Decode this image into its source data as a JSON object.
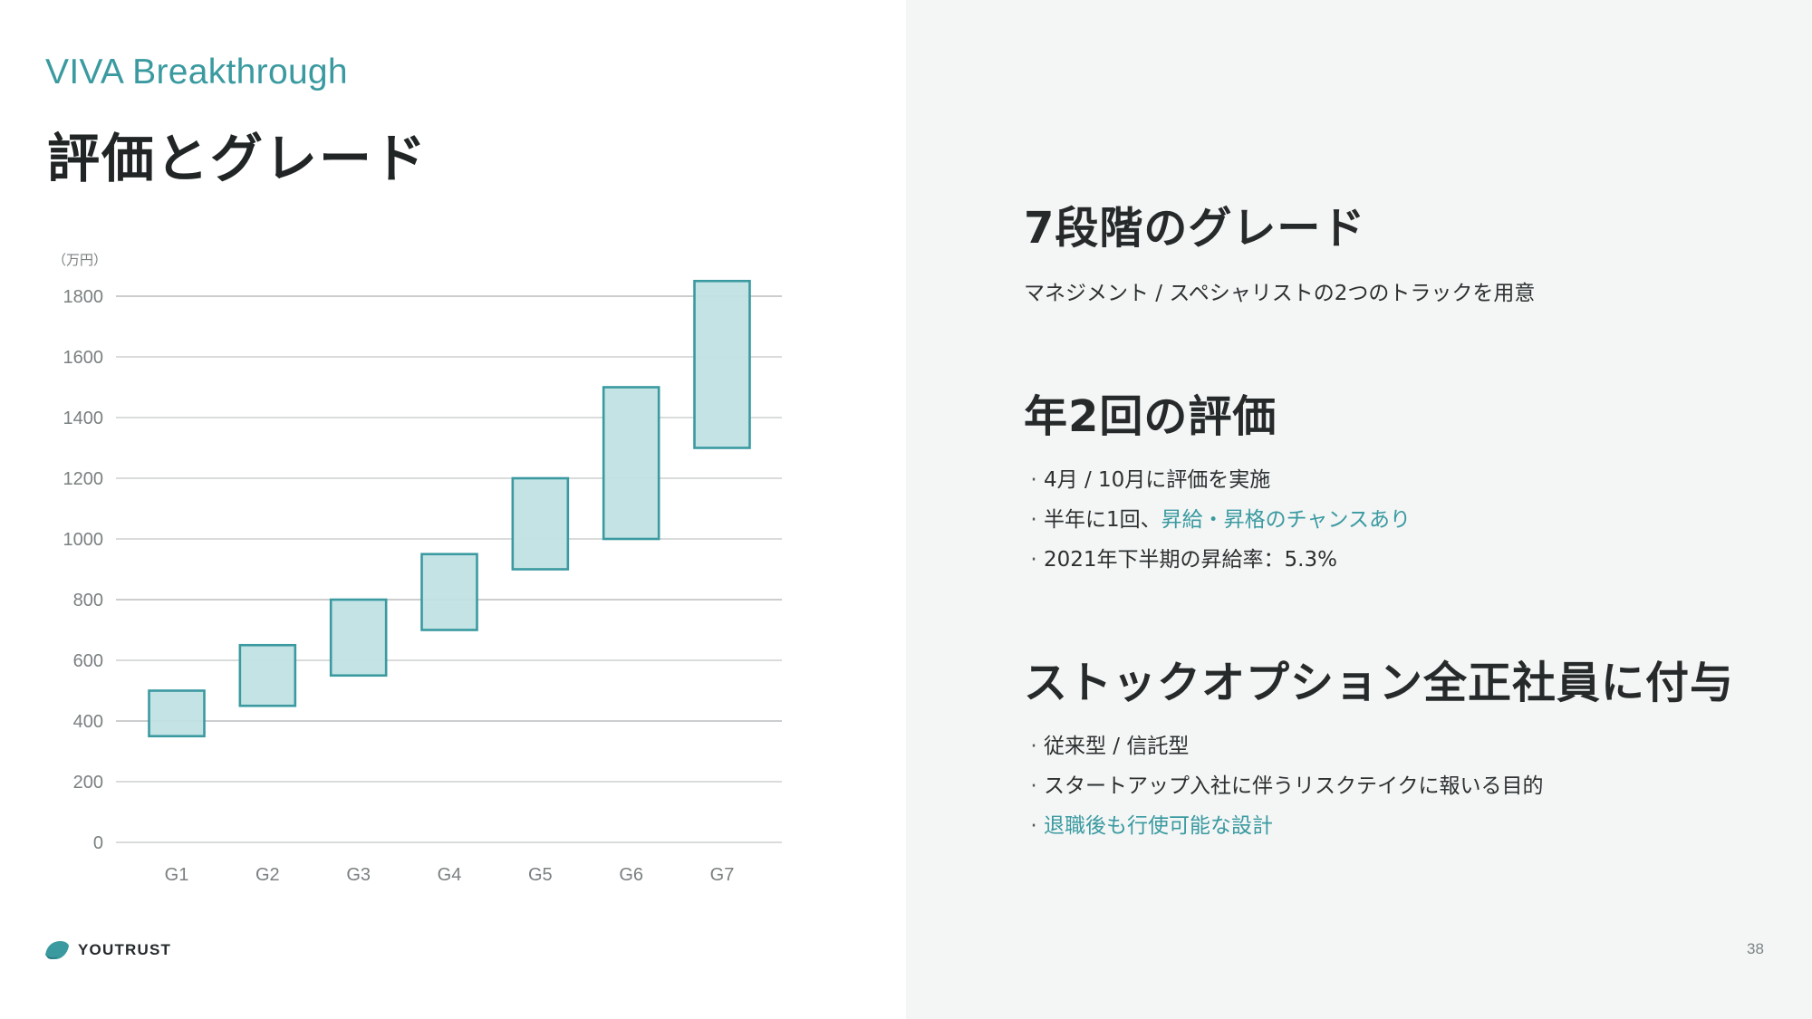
{
  "header": {
    "brand": "VIVA Breakthrough",
    "title": "評価とグレード"
  },
  "chart_data": {
    "type": "bar",
    "subtype": "floating-range",
    "title": "",
    "unit_label": "（万円）",
    "xlabel": "",
    "ylabel": "（万円）",
    "categories": [
      "G1",
      "G2",
      "G3",
      "G4",
      "G5",
      "G6",
      "G7"
    ],
    "ranges": [
      {
        "category": "G1",
        "low": 350,
        "high": 500
      },
      {
        "category": "G2",
        "low": 450,
        "high": 650
      },
      {
        "category": "G3",
        "low": 550,
        "high": 800
      },
      {
        "category": "G4",
        "low": 700,
        "high": 950
      },
      {
        "category": "G5",
        "low": 900,
        "high": 1200
      },
      {
        "category": "G6",
        "low": 1000,
        "high": 1500
      },
      {
        "category": "G7",
        "low": 1300,
        "high": 1850
      }
    ],
    "yticks": [
      0,
      200,
      400,
      600,
      800,
      1000,
      1200,
      1400,
      1600,
      1800
    ],
    "ylim": [
      0,
      1800
    ],
    "grid": true,
    "legend": "none",
    "colors": {
      "fill": "#c1e2e4",
      "stroke": "#3a9aa0",
      "grid": "#c4c6c7"
    }
  },
  "sections": [
    {
      "heading": "7段階のグレード",
      "sub": "マネジメント / スペシャリストの2つのトラックを用意"
    },
    {
      "heading": "年2回の評価",
      "bullets": [
        {
          "plain": "4月 / 10月に評価を実施",
          "accent": ""
        },
        {
          "plain": "半年に1回、",
          "accent": "昇給・昇格のチャンスあり"
        },
        {
          "plain": "2021年下半期の昇給率：5.3%",
          "accent": ""
        }
      ]
    },
    {
      "heading": "ストックオプション全正社員に付与",
      "bullets": [
        {
          "plain": "従来型 / 信託型",
          "accent": ""
        },
        {
          "plain": "スタートアップ入社に伴うリスクテイクに報いる目的",
          "accent": ""
        },
        {
          "plain": "",
          "accent": "退職後も行使可能な設計"
        }
      ]
    }
  ],
  "bullet_glyph": "·",
  "footer": {
    "logo_text": "YOUTRUST",
    "logo_icon": "youtrust-logo-icon",
    "page_number": "38"
  },
  "colors": {
    "accent": "#3a9aa0",
    "right_panel_bg": "#f4f6f6",
    "text": "#262a2b"
  }
}
